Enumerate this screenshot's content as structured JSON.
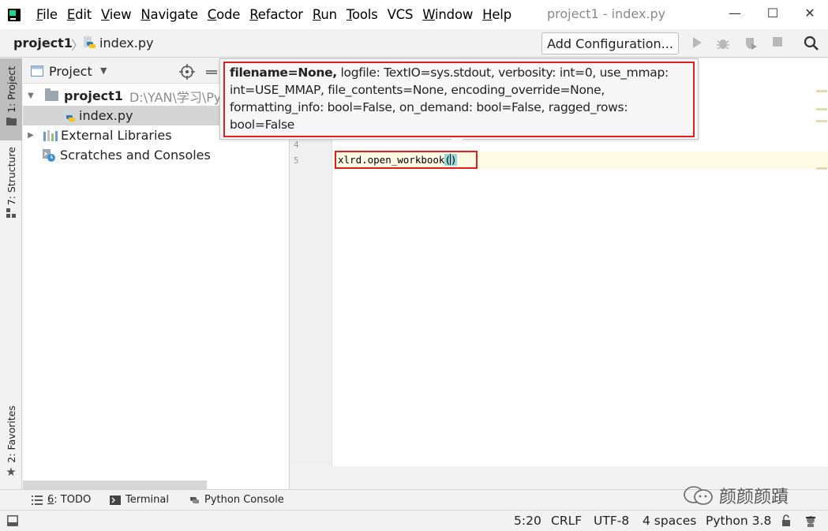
{
  "menu": {
    "items": [
      {
        "label": "File",
        "mnemonic": "F",
        "rest": "ile"
      },
      {
        "label": "Edit",
        "mnemonic": "E",
        "rest": "dit"
      },
      {
        "label": "View",
        "mnemonic": "V",
        "rest": "iew"
      },
      {
        "label": "Navigate",
        "mnemonic": "N",
        "rest": "avigate"
      },
      {
        "label": "Code",
        "mnemonic": "C",
        "rest": "ode"
      },
      {
        "label": "Refactor",
        "mnemonic": "R",
        "rest": "efactor"
      },
      {
        "label": "Run",
        "mnemonic": "R",
        "rest": "un"
      },
      {
        "label": "Tools",
        "mnemonic": "T",
        "rest": "ools"
      },
      {
        "label": "VCS",
        "mnemonic": "",
        "rest": "VCS"
      },
      {
        "label": "Window",
        "mnemonic": "W",
        "rest": "indow"
      },
      {
        "label": "Help",
        "mnemonic": "H",
        "rest": "elp"
      }
    ]
  },
  "window": {
    "title": "project1 - index.py",
    "minimize": "—",
    "maximize": "☐",
    "close": "✕"
  },
  "navbar": {
    "project": "project1",
    "separator": "〉",
    "file": "index.py",
    "add_configuration": "Add Configuration..."
  },
  "left_strip": {
    "project_tab": "1: Project",
    "structure_tab": "7: Structure",
    "favorites_tab": "2: Favorites"
  },
  "project_panel": {
    "title": "Project",
    "tree": {
      "root_name": "project1",
      "root_path": "D:\\YAN\\学习\\Pyt",
      "file": "index.py",
      "external": "External Libraries",
      "scratches": "Scratches and Consoles"
    }
  },
  "editor": {
    "line_4": "4",
    "line_5": "5",
    "code_before": "xlrd.open_workbook",
    "paren_open": "(",
    "paren_close": ")"
  },
  "tooltip": {
    "bold_part": "filename=None,",
    "rest_part": " logfile: TextIO=sys.stdout, verbosity: int=0, use_mmap: int=USE_MMAP, file_contents=None, encoding_override=None, formatting_info: bool=False, on_demand: bool=False, ragged_rows: bool=False"
  },
  "bottom_tabs": {
    "todo_num": "6",
    "todo_rest": ": TODO",
    "terminal": "Terminal",
    "python_console": "Python Console"
  },
  "watermark": {
    "text": "颜颜颜蹟"
  },
  "status": {
    "position": "5:20",
    "line_sep": "CRLF",
    "encoding": "UTF-8",
    "indent": "4 spaces",
    "interpreter": "Python 3.8"
  },
  "colors": {
    "highlight_box": "#e02020",
    "paren_match": "#93d9d9",
    "current_line": "#fffae3"
  }
}
